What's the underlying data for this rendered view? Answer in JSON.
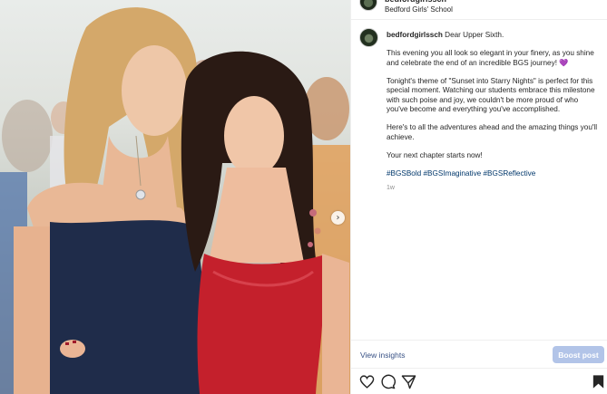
{
  "post": {
    "username": "bedfordgirlssch",
    "location": "Bedford Girls' School",
    "caption_opening": "Dear Upper Sixth.",
    "paragraphs": [
      "This evening you all look so elegant in your finery, as you shine and celebrate the end of an incredible BGS journey!",
      "Tonight's theme of \"Sunset into Starry Nights\" is perfect for this special moment. Watching our students embrace this milestone with such poise and joy, we couldn't be more proud of who you've become and everything you've accomplished.",
      "Here's to all the adventures ahead and the amazing things you'll achieve.",
      "Your next chapter starts now!"
    ],
    "heart_emoji": "💜",
    "hashtags": "#BGSBold #BGSImaginative #BGSReflective",
    "age": "1w"
  },
  "carousel": {
    "next_glyph": "›"
  },
  "footer": {
    "view_insights": "View insights",
    "boost_post": "Boost post"
  },
  "icons": {
    "like": "heart-outline-icon",
    "comment": "comment-bubble-icon",
    "share": "paper-plane-icon",
    "save": "bookmark-icon"
  },
  "colors": {
    "link": "#385185",
    "hashtag": "#00376b",
    "boost_button": "#b2c4e8",
    "dress_navy": "#1f2c4a",
    "dress_red": "#c4202c"
  }
}
